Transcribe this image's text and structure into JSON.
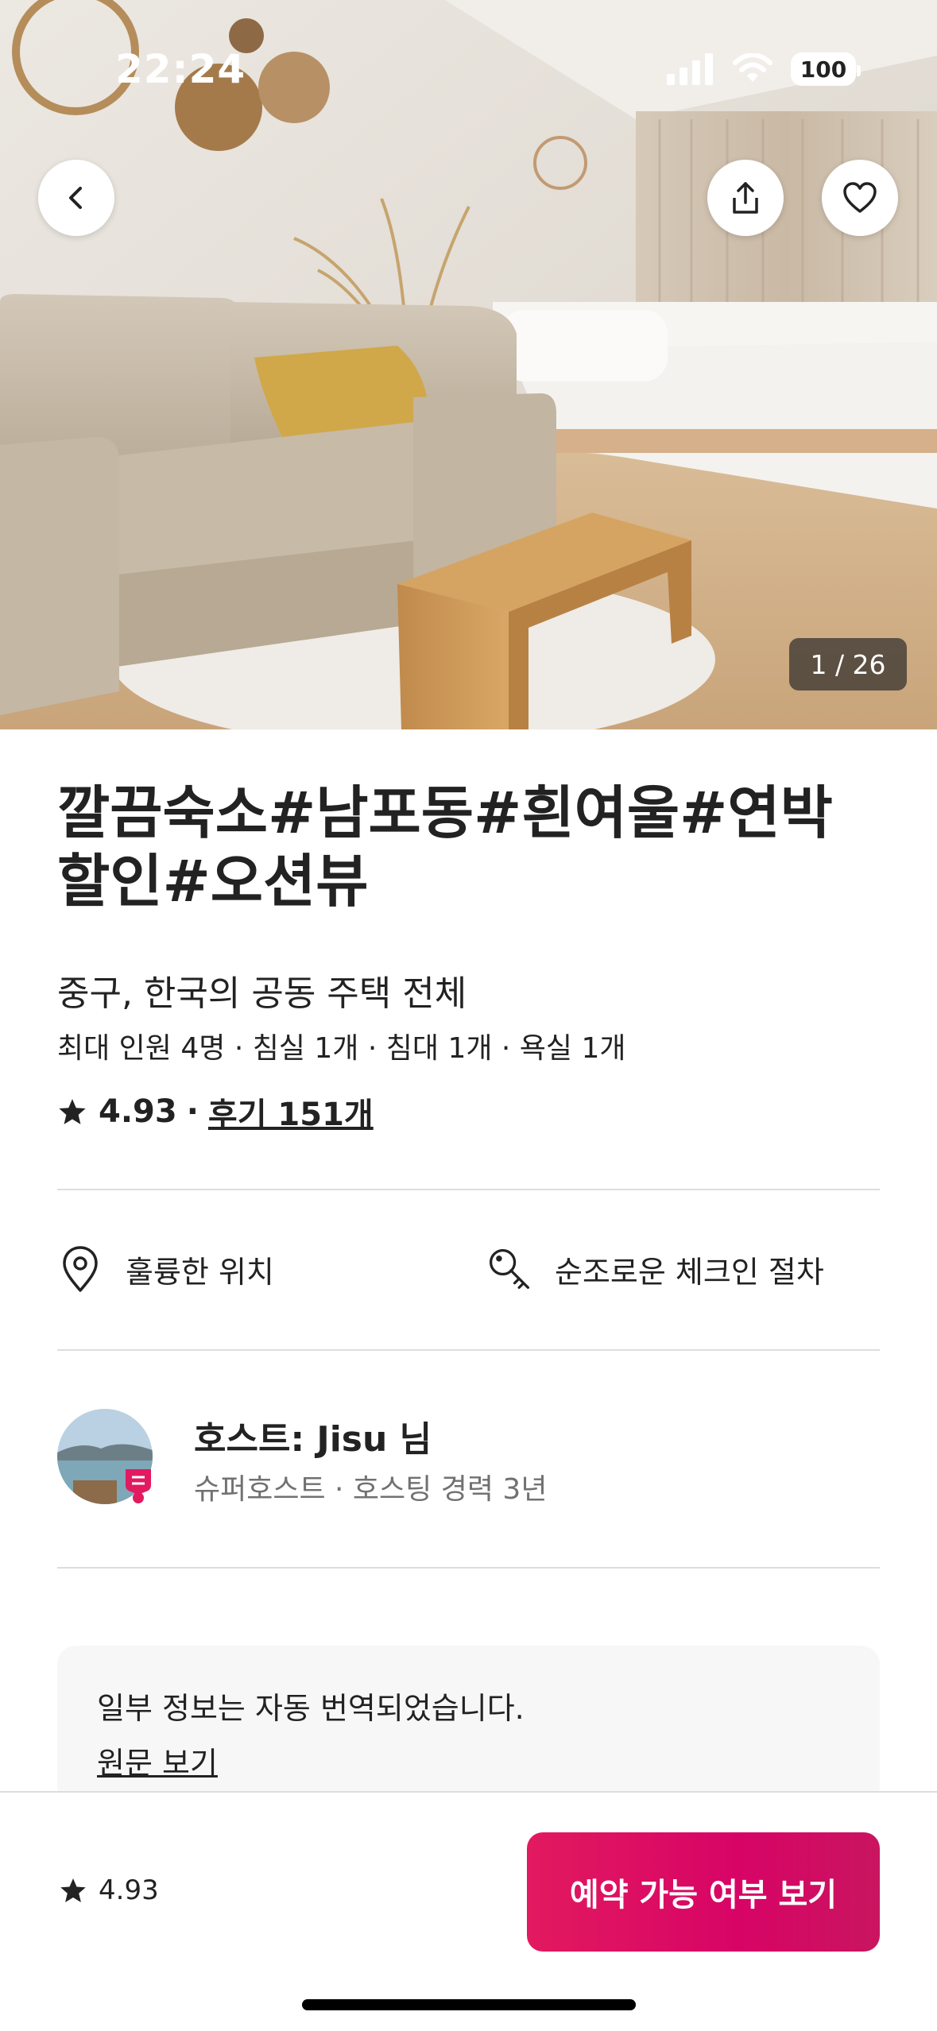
{
  "status_bar": {
    "time": "22:24",
    "battery": "100"
  },
  "hero": {
    "photo_counter": "1 / 26"
  },
  "listing": {
    "title": "깔끔숙소#남포동#흰여울#연박할인#오션뷰",
    "subtitle": "중구, 한국의 공동 주택 전체",
    "details": "최대 인원 4명 · 침실 1개 · 침대 1개 · 욕실 1개",
    "rating": "4.93",
    "rating_separator": "·",
    "reviews_link": "후기 151개"
  },
  "highlights": [
    {
      "icon": "location-pin-icon",
      "label": "훌륭한 위치"
    },
    {
      "icon": "key-icon",
      "label": "순조로운 체크인 절차"
    }
  ],
  "host": {
    "name": "호스트: Jisu 님",
    "info": "슈퍼호스트 · 호스팅 경력 3년"
  },
  "translation_notice": {
    "text": "일부 정보는 자동 번역되었습니다.",
    "link": "원문 보기"
  },
  "footer": {
    "rating": "4.93",
    "reserve_button": "예약 가능 여부 보기"
  },
  "colors": {
    "brand": "#E21A5F",
    "text": "#222222",
    "muted": "#717171",
    "divider": "#DDDDDD"
  }
}
